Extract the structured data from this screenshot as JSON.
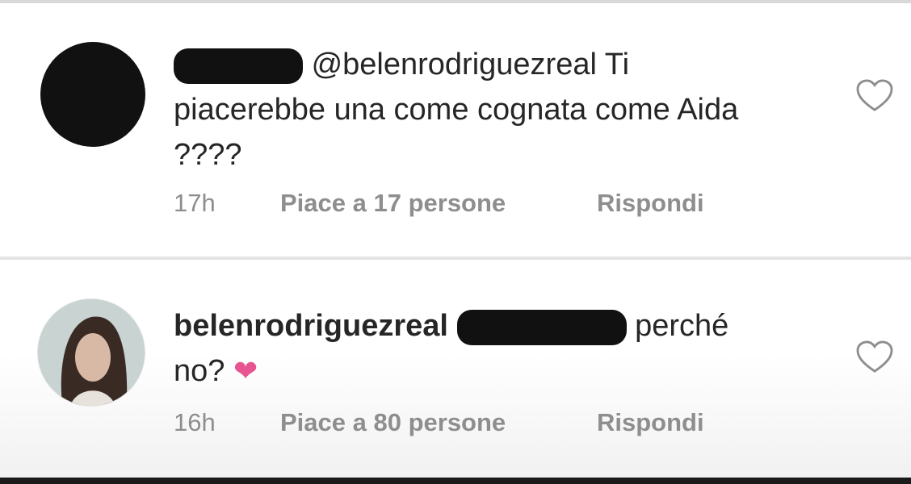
{
  "comments": [
    {
      "username_hidden": "username redacted",
      "mention": "@belenrodriguezreal",
      "text": "Ti piacerebbe una come cognata come Aida ????",
      "time": "17h",
      "likes": "Piace a 17 persone",
      "reply": "Rispondi"
    },
    {
      "username": "belenrodriguezreal",
      "mention_hidden": "@ mention redacted",
      "text": "perché no?",
      "emoji": "❤",
      "time": "16h",
      "likes": "Piace a 80 persone",
      "reply": "Rispondi"
    }
  ],
  "colors": {
    "text": "#262626",
    "meta": "#8e8e8e",
    "heart": "#e7548f",
    "censor": "#111111"
  },
  "icons": {
    "like": "heart-outline-icon",
    "avatar_blocked": "redacted-avatar",
    "avatar_user": "profile-photo"
  }
}
